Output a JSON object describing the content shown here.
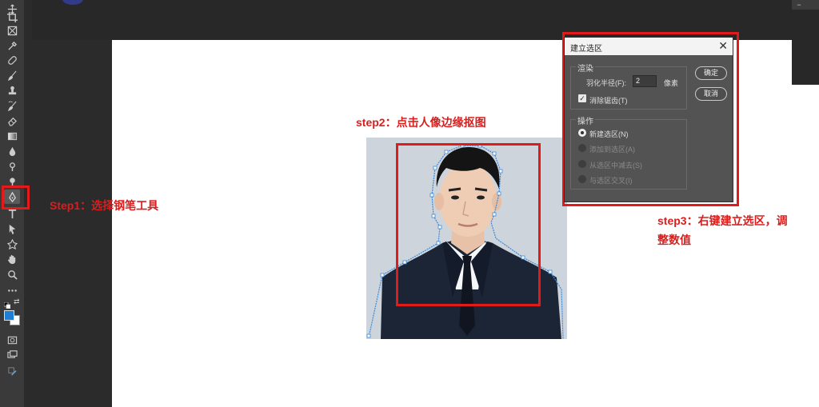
{
  "toolbar": {
    "tools": [
      {
        "icon": "move-icon",
        "glyph": "✥"
      },
      {
        "icon": "crop-icon",
        "glyph": "⌗"
      },
      {
        "icon": "frame-icon",
        "glyph": "⊠"
      },
      {
        "icon": "eyedropper-icon",
        "glyph": "✎"
      },
      {
        "icon": "healing-brush-icon",
        "glyph": "✚"
      },
      {
        "icon": "brush-icon",
        "glyph": "🖌"
      },
      {
        "icon": "clone-stamp-icon",
        "glyph": "♟"
      },
      {
        "icon": "history-brush-icon",
        "glyph": "↺"
      },
      {
        "icon": "eraser-icon",
        "glyph": "◩"
      },
      {
        "icon": "gradient-icon",
        "glyph": "▤"
      },
      {
        "icon": "blur-icon",
        "glyph": "💧"
      },
      {
        "icon": "dodge-icon",
        "glyph": "⚲"
      },
      {
        "icon": "burn-icon",
        "glyph": "●"
      },
      {
        "icon": "pen-tool-icon",
        "glyph": "✒"
      },
      {
        "icon": "type-tool-icon",
        "glyph": "T"
      },
      {
        "icon": "path-selection-icon",
        "glyph": "➤"
      },
      {
        "icon": "custom-shape-icon",
        "glyph": "✱"
      },
      {
        "icon": "hand-tool-icon",
        "glyph": "✋"
      },
      {
        "icon": "zoom-tool-icon",
        "glyph": "⌕"
      },
      {
        "icon": "more-tools-icon",
        "glyph": "⋯"
      }
    ],
    "active_tool": "pen-tool-icon",
    "foreground_color": "#1f7fd4",
    "background_color": "#ffffff"
  },
  "annotations": {
    "step1": "Step1：选择钢笔工具",
    "step2": "step2：点击人像边缘抠图",
    "step3_line1": "step3：右键建立选区，调",
    "step3_line2": "整数值",
    "color": "#d91e1e"
  },
  "dialog": {
    "title": "建立选区",
    "close_glyph": "✕",
    "render_section": "渲染",
    "feather_label": "羽化半径(F):",
    "feather_value": "2",
    "feather_unit": "像素",
    "antialias_label": "消除锯齿(T)",
    "antialias_checked": true,
    "operation_section": "操作",
    "options": [
      {
        "label": "新建选区(N)",
        "selected": true,
        "enabled": true
      },
      {
        "label": "添加到选区(A)",
        "selected": false,
        "enabled": false
      },
      {
        "label": "从选区中减去(S)",
        "selected": false,
        "enabled": false
      },
      {
        "label": "与选区交叉(I)",
        "selected": false,
        "enabled": false
      }
    ],
    "ok_button": "确定",
    "cancel_button": "取消"
  },
  "window_control": "−"
}
